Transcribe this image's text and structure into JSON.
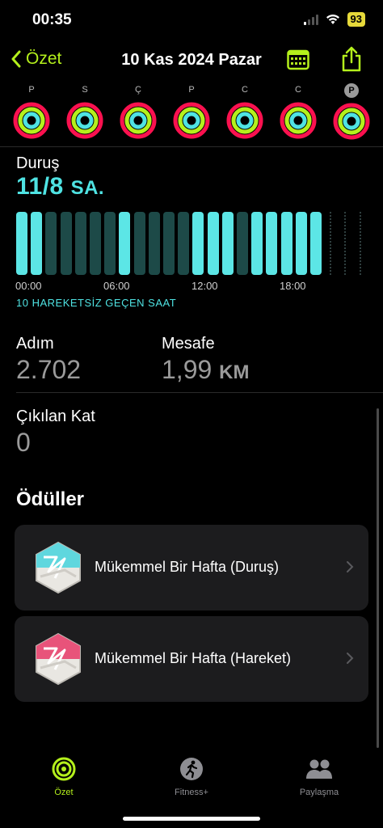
{
  "status": {
    "time": "00:35",
    "battery": "93"
  },
  "nav": {
    "back_label": "Özet",
    "title": "10 Kas 2024 Pazar"
  },
  "week": {
    "days": [
      {
        "letter": "P",
        "today": false
      },
      {
        "letter": "S",
        "today": false
      },
      {
        "letter": "Ç",
        "today": false
      },
      {
        "letter": "P",
        "today": false
      },
      {
        "letter": "C",
        "today": false
      },
      {
        "letter": "C",
        "today": false
      },
      {
        "letter": "P",
        "today": true
      }
    ],
    "colors": {
      "move": "#fa114f",
      "exercise": "#b4f01c",
      "stand": "#4fe3e3"
    }
  },
  "stand": {
    "label": "Duruş",
    "value": "11/8",
    "unit": "SA.",
    "axis": [
      "00:00",
      "06:00",
      "12:00",
      "18:00"
    ],
    "inactive_text": "10 HAREKETSİZ GEÇEN SAAT",
    "hours_stood": [
      1,
      1,
      0,
      0,
      0,
      0,
      0,
      1,
      0,
      0,
      0,
      0,
      1,
      1,
      1,
      0,
      1,
      1,
      1,
      1,
      1,
      0,
      0,
      0
    ],
    "hours_recorded": 21,
    "colors": {
      "active": "#5ce6e6",
      "inactive": "#1d4a48",
      "empty": "#2f3f3f"
    }
  },
  "metrics": {
    "steps": {
      "label": "Adım",
      "value": "2.702"
    },
    "distance": {
      "label": "Mesafe",
      "value": "1,99",
      "unit": "KM"
    },
    "floors": {
      "label": "Çıkılan Kat",
      "value": "0"
    }
  },
  "awards": {
    "title": "Ödüller",
    "items": [
      {
        "label": "Mükemmel Bir Hafta (Duruş)",
        "color": "#5fd7de",
        "icon": "stand-award-badge-icon"
      },
      {
        "label": "Mükemmel Bir Hafta (Hareket)",
        "color": "#e8537a",
        "icon": "move-award-badge-icon"
      }
    ]
  },
  "tabs": [
    {
      "label": "Özet",
      "icon": "activity-rings-icon",
      "active": true
    },
    {
      "label": "Fitness+",
      "icon": "running-figure-icon",
      "active": false
    },
    {
      "label": "Paylaşma",
      "icon": "people-icon",
      "active": false
    }
  ]
}
